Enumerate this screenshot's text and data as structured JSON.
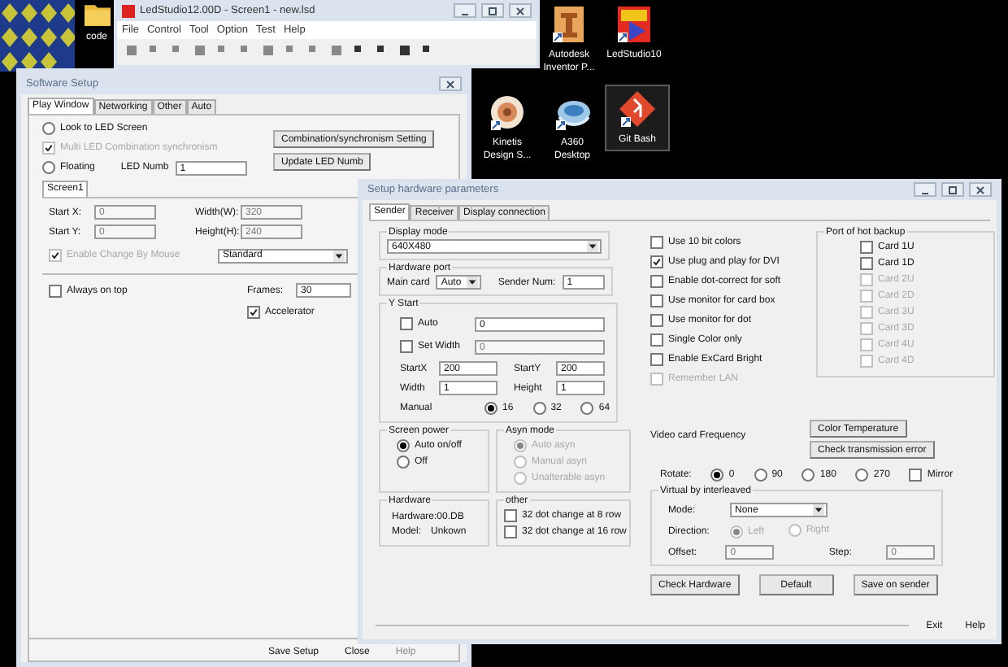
{
  "desktop_icons": [
    {
      "kind": "folder",
      "label": "code",
      "selected": false
    },
    {
      "kind": "inventor",
      "label": "Autodesk Inventor P...",
      "selected": false
    },
    {
      "kind": "ledstudio",
      "label": "LedStudio10",
      "selected": false
    },
    {
      "kind": "kinetis",
      "label": "Kinetis Design S...",
      "selected": false
    },
    {
      "kind": "a360",
      "label": "A360 Desktop",
      "selected": false
    },
    {
      "kind": "git",
      "label": "Git Bash",
      "selected": true
    }
  ],
  "main_window": {
    "title": "LedStudio12.00D - Screen1 - new.lsd",
    "menu": [
      "File",
      "Control",
      "Tool",
      "Option",
      "Test",
      "Help"
    ]
  },
  "software_setup": {
    "title": "Software Setup",
    "tabs": [
      {
        "label": "Play Window",
        "selected": true
      },
      {
        "label": "Networking",
        "selected": false
      },
      {
        "label": "Other",
        "selected": false
      },
      {
        "label": "Auto",
        "selected": false
      }
    ],
    "look_to_led": {
      "label": "Look to LED Screen",
      "selected": false
    },
    "multi_led": {
      "label": "Multi LED Combination synchronism",
      "checked": true,
      "disabled": true
    },
    "floating": {
      "label": "Floating",
      "selected": false
    },
    "led_numb": {
      "label": "LED Numb",
      "value": "1"
    },
    "combination_button": "Combination/synchronism Setting",
    "update_button": "Update LED Numb",
    "screen_tabs": [
      {
        "label": "Screen1",
        "selected": true
      }
    ],
    "fields": [
      {
        "label": "Start X:",
        "value": "0",
        "disabled": true
      },
      {
        "label": "Width(W):",
        "value": "320",
        "disabled": true
      },
      {
        "label": "Start Y:",
        "value": "0",
        "disabled": true
      },
      {
        "label": "Height(H):",
        "value": "240",
        "disabled": true
      }
    ],
    "enable_change": {
      "label": "Enable Change By Mouse",
      "checked": true,
      "disabled": true
    },
    "mode_dropdown": "Standard",
    "always_on_top": {
      "label": "Always on top",
      "checked": false
    },
    "frames": {
      "label": "Frames:",
      "value": "30"
    },
    "accelerator": {
      "label": "Accelerator",
      "checked": true
    },
    "buttons": [
      {
        "label": "Save Setup",
        "disabled": false
      },
      {
        "label": "Close",
        "disabled": false
      },
      {
        "label": "Help",
        "disabled": true
      }
    ]
  },
  "hardware": {
    "title": "Setup hardware parameters",
    "tabs": [
      {
        "label": "Sender",
        "selected": true
      },
      {
        "label": "Receiver",
        "selected": false
      },
      {
        "label": "Display connection",
        "selected": false
      }
    ],
    "display_mode": {
      "title": "Display mode",
      "value": "640X480"
    },
    "hardware_port": {
      "title": "Hardware port",
      "main_card_label": "Main card",
      "main_card": "Auto",
      "sender_num_label": "Sender Num:",
      "sender_num": "1"
    },
    "y_start": {
      "title": "Y Start",
      "auto": {
        "label": "Auto",
        "checked": false
      },
      "auto_field": {
        "value": "0",
        "disabled": false
      },
      "set_width": {
        "label": "Set Width",
        "checked": false
      },
      "set_width_field": {
        "value": "0",
        "disabled": true
      },
      "fields": [
        {
          "label": "StartX",
          "value": "200"
        },
        {
          "label": "StartY",
          "value": "200"
        },
        {
          "label": "Width",
          "value": "1"
        },
        {
          "label": "Height",
          "value": "1"
        }
      ],
      "manual_label": "Manual",
      "manual_options": [
        {
          "label": "16",
          "selected": true
        },
        {
          "label": "32",
          "selected": false
        },
        {
          "label": "64",
          "selected": false
        }
      ]
    },
    "screen_power": {
      "title": "Screen power",
      "options": [
        {
          "label": "Auto on/off",
          "selected": true
        },
        {
          "label": "Off",
          "selected": false
        }
      ]
    },
    "asyn_mode": {
      "title": "Asyn mode",
      "disabled": true,
      "options": [
        {
          "label": "Auto asyn",
          "selected": true
        },
        {
          "label": "Manual asyn",
          "selected": false
        },
        {
          "label": "Unalterable asyn",
          "selected": false
        }
      ]
    },
    "hardware_info": {
      "title": "Hardware",
      "version": "Hardware:00.DB",
      "model_label": "Model:",
      "model": "Unkown"
    },
    "other": {
      "title": "other",
      "options": [
        {
          "label": "32 dot change at 8 row",
          "checked": false
        },
        {
          "label": "32 dot change at 16 row",
          "checked": false
        }
      ]
    },
    "options": [
      {
        "label": "Use 10 bit colors",
        "checked": false,
        "disabled": false
      },
      {
        "label": "Use plug and play for DVI",
        "checked": true,
        "disabled": false
      },
      {
        "label": "Enable dot-correct for soft",
        "checked": false,
        "disabled": false
      },
      {
        "label": "Use monitor for card box",
        "checked": false,
        "disabled": false
      },
      {
        "label": "Use monitor for dot",
        "checked": false,
        "disabled": false
      },
      {
        "label": "Single Color only",
        "checked": false,
        "disabled": false
      },
      {
        "label": "Enable ExCard Bright",
        "checked": false,
        "disabled": false
      },
      {
        "label": "Remember LAN",
        "checked": false,
        "disabled": true
      }
    ],
    "hot_backup": {
      "title": "Port of hot backup",
      "cards": [
        {
          "label": "Card 1U",
          "checked": false,
          "disabled": false
        },
        {
          "label": "Card 1D",
          "checked": false,
          "disabled": false
        },
        {
          "label": "Card 2U",
          "checked": false,
          "disabled": true
        },
        {
          "label": "Card 2D",
          "checked": false,
          "disabled": true
        },
        {
          "label": "Card 3U",
          "checked": false,
          "disabled": true
        },
        {
          "label": "Card 3D",
          "checked": false,
          "disabled": true
        },
        {
          "label": "Card 4U",
          "checked": false,
          "disabled": true
        },
        {
          "label": "Card 4D",
          "checked": false,
          "disabled": true
        }
      ]
    },
    "video_card_label": "Video card Frequency",
    "color_temp_button": "Color Temperature",
    "check_error_button": "Check transmission error",
    "rotate": {
      "label": "Rotate:",
      "options": [
        {
          "label": "0",
          "selected": true
        },
        {
          "label": "90",
          "selected": false
        },
        {
          "label": "180",
          "selected": false
        },
        {
          "label": "270",
          "selected": false
        }
      ],
      "mirror": {
        "label": "Mirror",
        "checked": false
      }
    },
    "interleaved": {
      "title": "Virtual by interleaved",
      "mode_label": "Mode:",
      "mode": "None",
      "direction_label": "Direction:",
      "directions_disabled": true,
      "directions": [
        {
          "label": "Left",
          "selected": true
        },
        {
          "label": "Right",
          "selected": false
        }
      ],
      "offset_label": "Offset:",
      "offset": {
        "value": "0",
        "disabled": true
      },
      "step_label": "Step:",
      "step": {
        "value": "0",
        "disabled": true
      }
    },
    "actions": [
      "Check Hardware",
      "Default",
      "Save on sender"
    ],
    "footer": [
      "Exit",
      "Help"
    ]
  }
}
